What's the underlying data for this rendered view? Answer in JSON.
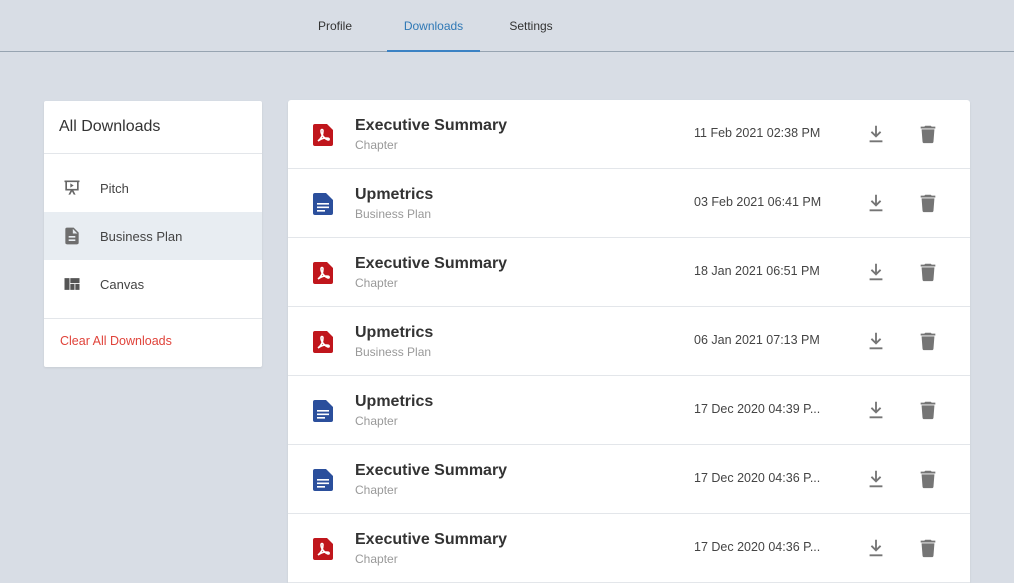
{
  "tabs": [
    {
      "label": "Profile",
      "active": false
    },
    {
      "label": "Downloads",
      "active": true
    },
    {
      "label": "Settings",
      "active": false
    }
  ],
  "sidebar": {
    "title": "All Downloads",
    "items": [
      {
        "label": "Pitch",
        "icon": "presentation-icon",
        "active": false
      },
      {
        "label": "Business Plan",
        "icon": "document-icon",
        "active": true
      },
      {
        "label": "Canvas",
        "icon": "canvas-grid-icon",
        "active": false
      }
    ],
    "clear_label": "Clear All Downloads"
  },
  "downloads": [
    {
      "title": "Executive Summary",
      "subtitle": "Chapter",
      "date": "11 Feb 2021 02:38 PM",
      "type": "pdf-icon"
    },
    {
      "title": "Upmetrics",
      "subtitle": "Business Plan",
      "date": "03 Feb 2021 06:41 PM",
      "type": "doc-icon"
    },
    {
      "title": "Executive Summary",
      "subtitle": "Chapter",
      "date": "18 Jan 2021 06:51 PM",
      "type": "pdf-icon"
    },
    {
      "title": "Upmetrics",
      "subtitle": "Business Plan",
      "date": "06 Jan 2021 07:13 PM",
      "type": "pdf-icon"
    },
    {
      "title": "Upmetrics",
      "subtitle": "Chapter",
      "date": "17 Dec 2020 04:39 P...",
      "type": "doc-icon"
    },
    {
      "title": "Executive Summary",
      "subtitle": "Chapter",
      "date": "17 Dec 2020 04:36 P...",
      "type": "doc-icon"
    },
    {
      "title": "Executive Summary",
      "subtitle": "Chapter",
      "date": "17 Dec 2020 04:36 P...",
      "type": "pdf-icon"
    }
  ],
  "colors": {
    "accent": "#2f78b5",
    "danger": "#e0433a",
    "pdf": "#c0161c",
    "doc": "#2b4f9c",
    "icon_gray": "#757575"
  }
}
